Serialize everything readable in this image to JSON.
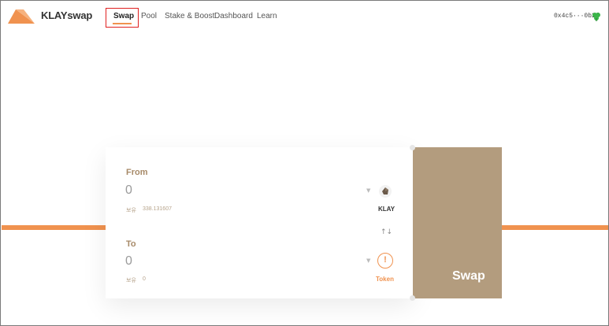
{
  "header": {
    "logo_text": "KLAYswap",
    "wallet_address": "0x4c5···0b2f"
  },
  "nav": {
    "swap": "Swap",
    "pool": "Pool",
    "stake": "Stake & Boost",
    "dashboard": "Dashboard",
    "learn": "Learn"
  },
  "swap_form": {
    "from": {
      "label": "From",
      "amount": "0",
      "balance_label": "보유",
      "balance_value": "338.131607",
      "token_symbol": "KLAY",
      "token_icon": "klay-token-icon"
    },
    "switch_icon": "swap-direction-icon",
    "to": {
      "label": "To",
      "amount": "0",
      "balance_label": "보유",
      "balance_value": "0",
      "token_symbol": "Token",
      "token_icon": "warning-icon"
    },
    "submit_label": "Swap"
  },
  "colors": {
    "accent": "#f0924f",
    "submit_bg": "#b39c7e",
    "label": "#a78a68",
    "highlight_box": "#e02020"
  }
}
